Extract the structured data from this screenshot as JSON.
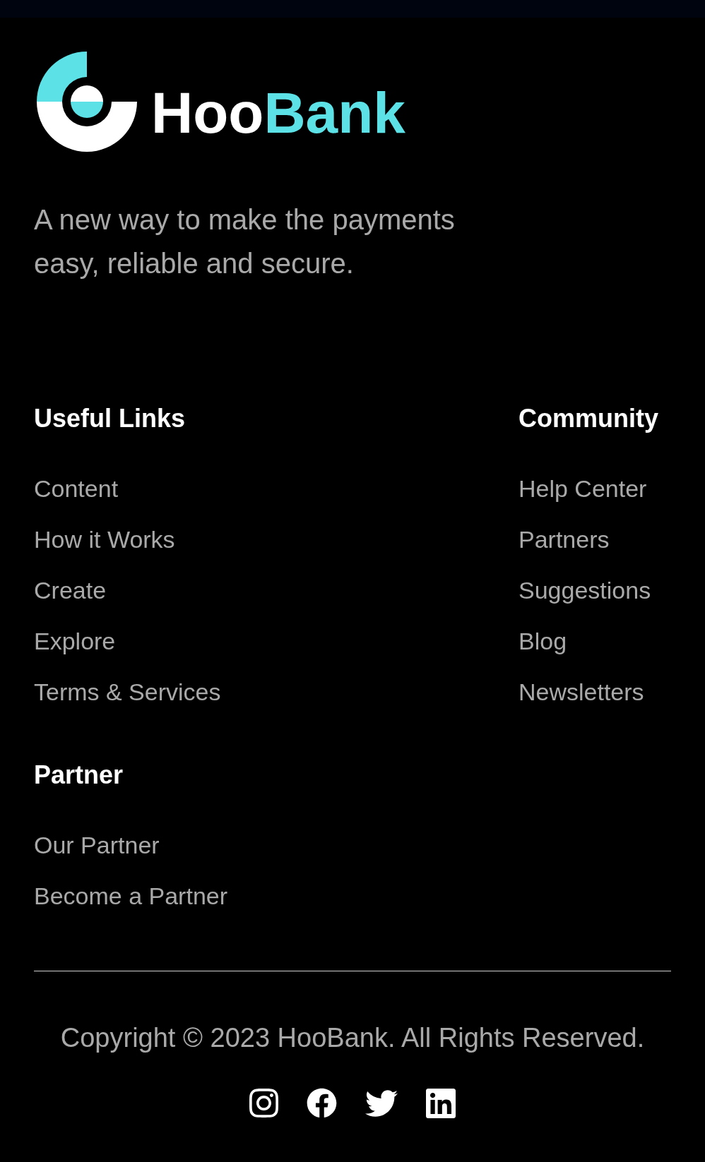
{
  "logo": {
    "wordmark": [
      {
        "text": "Hoo",
        "color": "#ffffff"
      },
      {
        "text": "Bank",
        "color": "#5ce1e6"
      }
    ]
  },
  "tagline": "A new way to make the payments easy, reliable and secure.",
  "link_groups": [
    {
      "heading": "Useful Links",
      "links": [
        "Content",
        "How it Works",
        "Create",
        "Explore",
        "Terms & Services"
      ]
    },
    {
      "heading": "Community",
      "links": [
        "Help Center",
        "Partners",
        "Suggestions",
        "Blog",
        "Newsletters"
      ]
    },
    {
      "heading": "Partner",
      "links": [
        "Our Partner",
        "Become a Partner"
      ]
    }
  ],
  "copyright": "Copyright © 2023 HooBank. All Rights Reserved.",
  "social_links": [
    {
      "kind": "instagram"
    },
    {
      "kind": "facebook"
    },
    {
      "kind": "twitter"
    },
    {
      "kind": "linkedin"
    }
  ]
}
